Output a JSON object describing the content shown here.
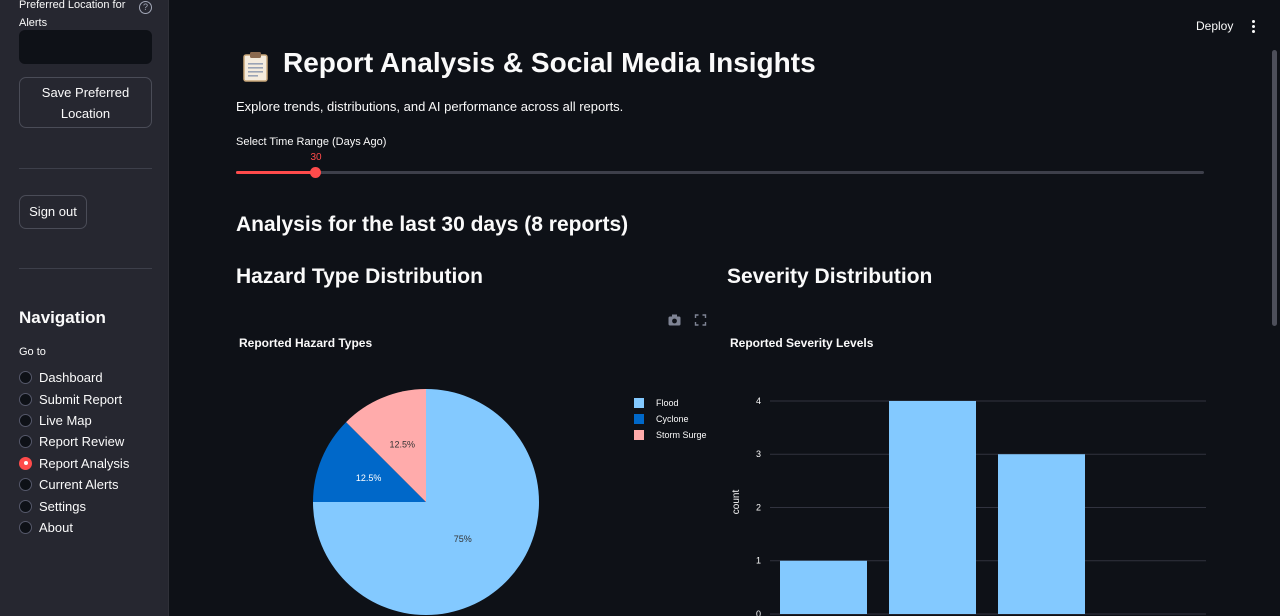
{
  "sidebar": {
    "pref_location_label": "Preferred Location for Alerts",
    "save_button": "Save Preferred Location",
    "signout_button": "Sign out",
    "nav_title": "Navigation",
    "goto_label": "Go to",
    "nav_items": [
      {
        "label": "Dashboard",
        "selected": false
      },
      {
        "label": "Submit Report",
        "selected": false
      },
      {
        "label": "Live Map",
        "selected": false
      },
      {
        "label": "Report Review",
        "selected": false
      },
      {
        "label": "Report Analysis",
        "selected": true
      },
      {
        "label": "Current Alerts",
        "selected": false
      },
      {
        "label": "Settings",
        "selected": false
      },
      {
        "label": "About",
        "selected": false
      }
    ]
  },
  "topbar": {
    "deploy": "Deploy"
  },
  "main": {
    "page_icon": "clipboard-icon",
    "title": "Report Analysis & Social Media Insights",
    "subtitle": "Explore trends, distributions, and AI performance across all reports.",
    "slider": {
      "label": "Select Time Range (Days Ago)",
      "value": 30,
      "value_label": "30"
    },
    "analysis_heading": "Analysis for the last 30 days (8 reports)",
    "hazard_heading": "Hazard Type Distribution",
    "severity_heading": "Severity Distribution"
  },
  "colors": {
    "accent": "#ff4b4b",
    "flood": "#83c9ff",
    "cyclone": "#0068c9",
    "storm_surge": "#ffabab",
    "background": "#0e1117",
    "sidebar": "#262730"
  },
  "chart_data": [
    {
      "type": "pie",
      "title": "Reported Hazard Types",
      "labels": [
        "Flood",
        "Cyclone",
        "Storm Surge"
      ],
      "values": [
        75,
        12.5,
        12.5
      ],
      "value_labels": [
        "75%",
        "12.5%",
        "12.5%"
      ],
      "colors": [
        "#83c9ff",
        "#0068c9",
        "#ffabab"
      ],
      "legend": "right"
    },
    {
      "type": "bar",
      "title": "Reported Severity Levels",
      "ylabel": "count",
      "xlabel": "",
      "values": [
        1,
        4,
        3
      ],
      "yticks": [
        "0",
        "1",
        "2",
        "3",
        "4"
      ],
      "ylim": [
        0,
        4.3
      ],
      "color": "#83c9ff",
      "grid": true
    }
  ]
}
